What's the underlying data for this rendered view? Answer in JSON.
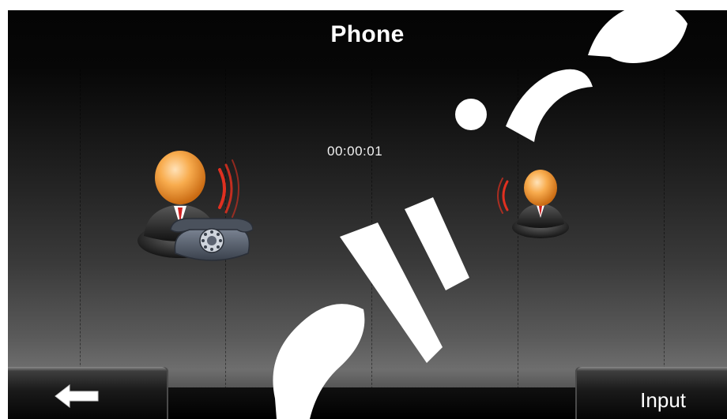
{
  "header": {
    "title": "Phone"
  },
  "call": {
    "timer": "00:00:01"
  },
  "footer": {
    "input_label": "Input"
  },
  "icons": {
    "back": "left-arrow-icon",
    "caller": "caller-avatar-with-telephone-icon",
    "callee": "callee-avatar-icon"
  },
  "colors": {
    "title_text": "#ffffff",
    "avatar_head": "#f5a040",
    "ringing_waves": "#e03020"
  }
}
